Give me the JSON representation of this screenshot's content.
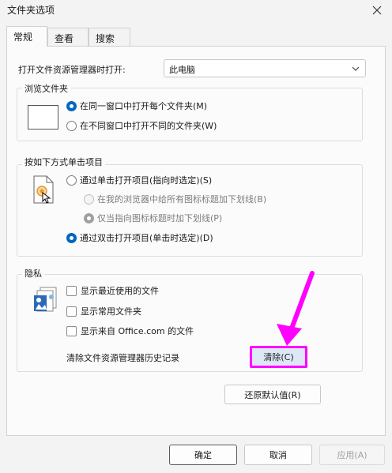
{
  "window": {
    "title": "文件夹选项"
  },
  "tabs": [
    {
      "label": "常规"
    },
    {
      "label": "查看"
    },
    {
      "label": "搜索"
    }
  ],
  "open_explorer": {
    "label": "打开文件资源管理器时打开:",
    "value": "此电脑"
  },
  "browse": {
    "title": "浏览文件夹",
    "options": [
      {
        "label": "在同一窗口中打开每个文件夹(M)",
        "selected": true
      },
      {
        "label": "在不同窗口中打开不同的文件夹(W)",
        "selected": false
      }
    ]
  },
  "click": {
    "title": "按如下方式单击项目",
    "single": {
      "label": "通过单击打开项目(指向时选定)(S)",
      "selected": false
    },
    "sub": [
      {
        "label": "在我的浏览器中给所有图标标题加下划线(B)",
        "selected": false
      },
      {
        "label": "仅当指向图标标题时加下划线(P)",
        "selected": true
      }
    ],
    "double": {
      "label": "通过双击打开项目(单击时选定)(D)",
      "selected": true
    }
  },
  "privacy": {
    "title": "隐私",
    "checks": [
      {
        "label": "显示最近使用的文件",
        "checked": false
      },
      {
        "label": "显示常用文件夹",
        "checked": false
      },
      {
        "label": "显示来自 Office.com 的文件",
        "checked": false
      }
    ],
    "clear_label": "清除文件资源管理器历史记录",
    "clear_button": "清除(C)"
  },
  "restore_button": "还原默认值(R)",
  "footer": {
    "ok": "确定",
    "cancel": "取消",
    "apply": "应用(A)"
  },
  "colors": {
    "accent": "#0067c0",
    "annotation": "#ff00ff",
    "clear_btn_bg": "#dde8f7"
  },
  "icons": [
    "close-icon",
    "chevron-down-icon",
    "folder-window-icon",
    "click-hand-icon",
    "privacy-files-icon",
    "annotation-arrow-icon"
  ]
}
